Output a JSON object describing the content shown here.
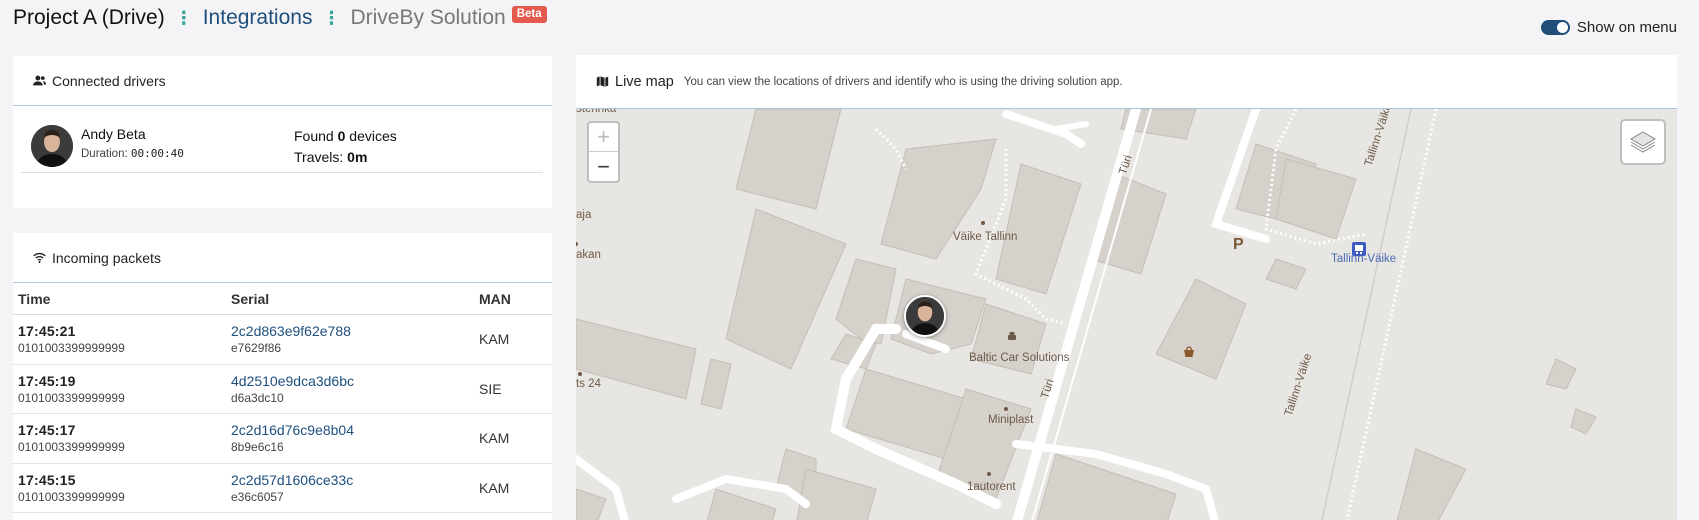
{
  "breadcrumb": {
    "project": "Project A (Drive)",
    "integrations": "Integrations",
    "current": "DriveBy Solution",
    "badge": "Beta"
  },
  "menu_toggle": {
    "label": "Show on menu",
    "enabled": true
  },
  "drivers": {
    "title": "Connected drivers",
    "items": [
      {
        "name": "Andy Beta",
        "duration_label": "Duration:",
        "duration": "00:00:40",
        "found_prefix": "Found ",
        "found_count": "0",
        "found_suffix": " devices",
        "travels_label": "Travels: ",
        "travels_value": "0m"
      }
    ]
  },
  "packets": {
    "title": "Incoming packets",
    "columns": [
      "Time",
      "Serial",
      "MAN"
    ],
    "rows": [
      {
        "time": "17:45:21",
        "imei": "0101003399999999",
        "serial": "2c2d863e9f62e788",
        "serial_sub": "e7629f86",
        "man": "KAM"
      },
      {
        "time": "17:45:19",
        "imei": "0101003399999999",
        "serial": "4d2510e9dca3d6bc",
        "serial_sub": "d6a3dc10",
        "man": "SIE"
      },
      {
        "time": "17:45:17",
        "imei": "0101003399999999",
        "serial": "2c2d16d76c9e8b04",
        "serial_sub": "8b9e6c16",
        "man": "KAM"
      },
      {
        "time": "17:45:15",
        "imei": "0101003399999999",
        "serial": "2c2d57d1606ce33c",
        "serial_sub": "e36c6057",
        "man": "KAM"
      }
    ]
  },
  "map": {
    "title": "Live map",
    "description": "You can view the locations of drivers and identify who is using the driving solution app.",
    "zoom_in": "+",
    "zoom_out": "−",
    "labels": {
      "vaike_tallinn": "Väike Tallinn",
      "baltic_car": "Baltic Car Solutions",
      "miniplast": "Miniplast",
      "autorent": "1autorent",
      "tallinn_vaike": "Tallinn-Väike",
      "turi_1": "Türi",
      "turi_2": "Türi",
      "tallinn_vaike_road_1": "Tallinn-Väike",
      "tallinn_vaike_road_2": "Tallinn-Väike",
      "parking": "P",
      "edge_sterinka": "sterinka",
      "edge_aja": "aja",
      "edge_akan": "akan",
      "edge_ts24": "ts 24"
    }
  },
  "colors": {
    "accent": "#1e4f7d",
    "badge": "#e35a4d",
    "separator": "#3aa39a",
    "map_bg": "#e8e6e2"
  }
}
